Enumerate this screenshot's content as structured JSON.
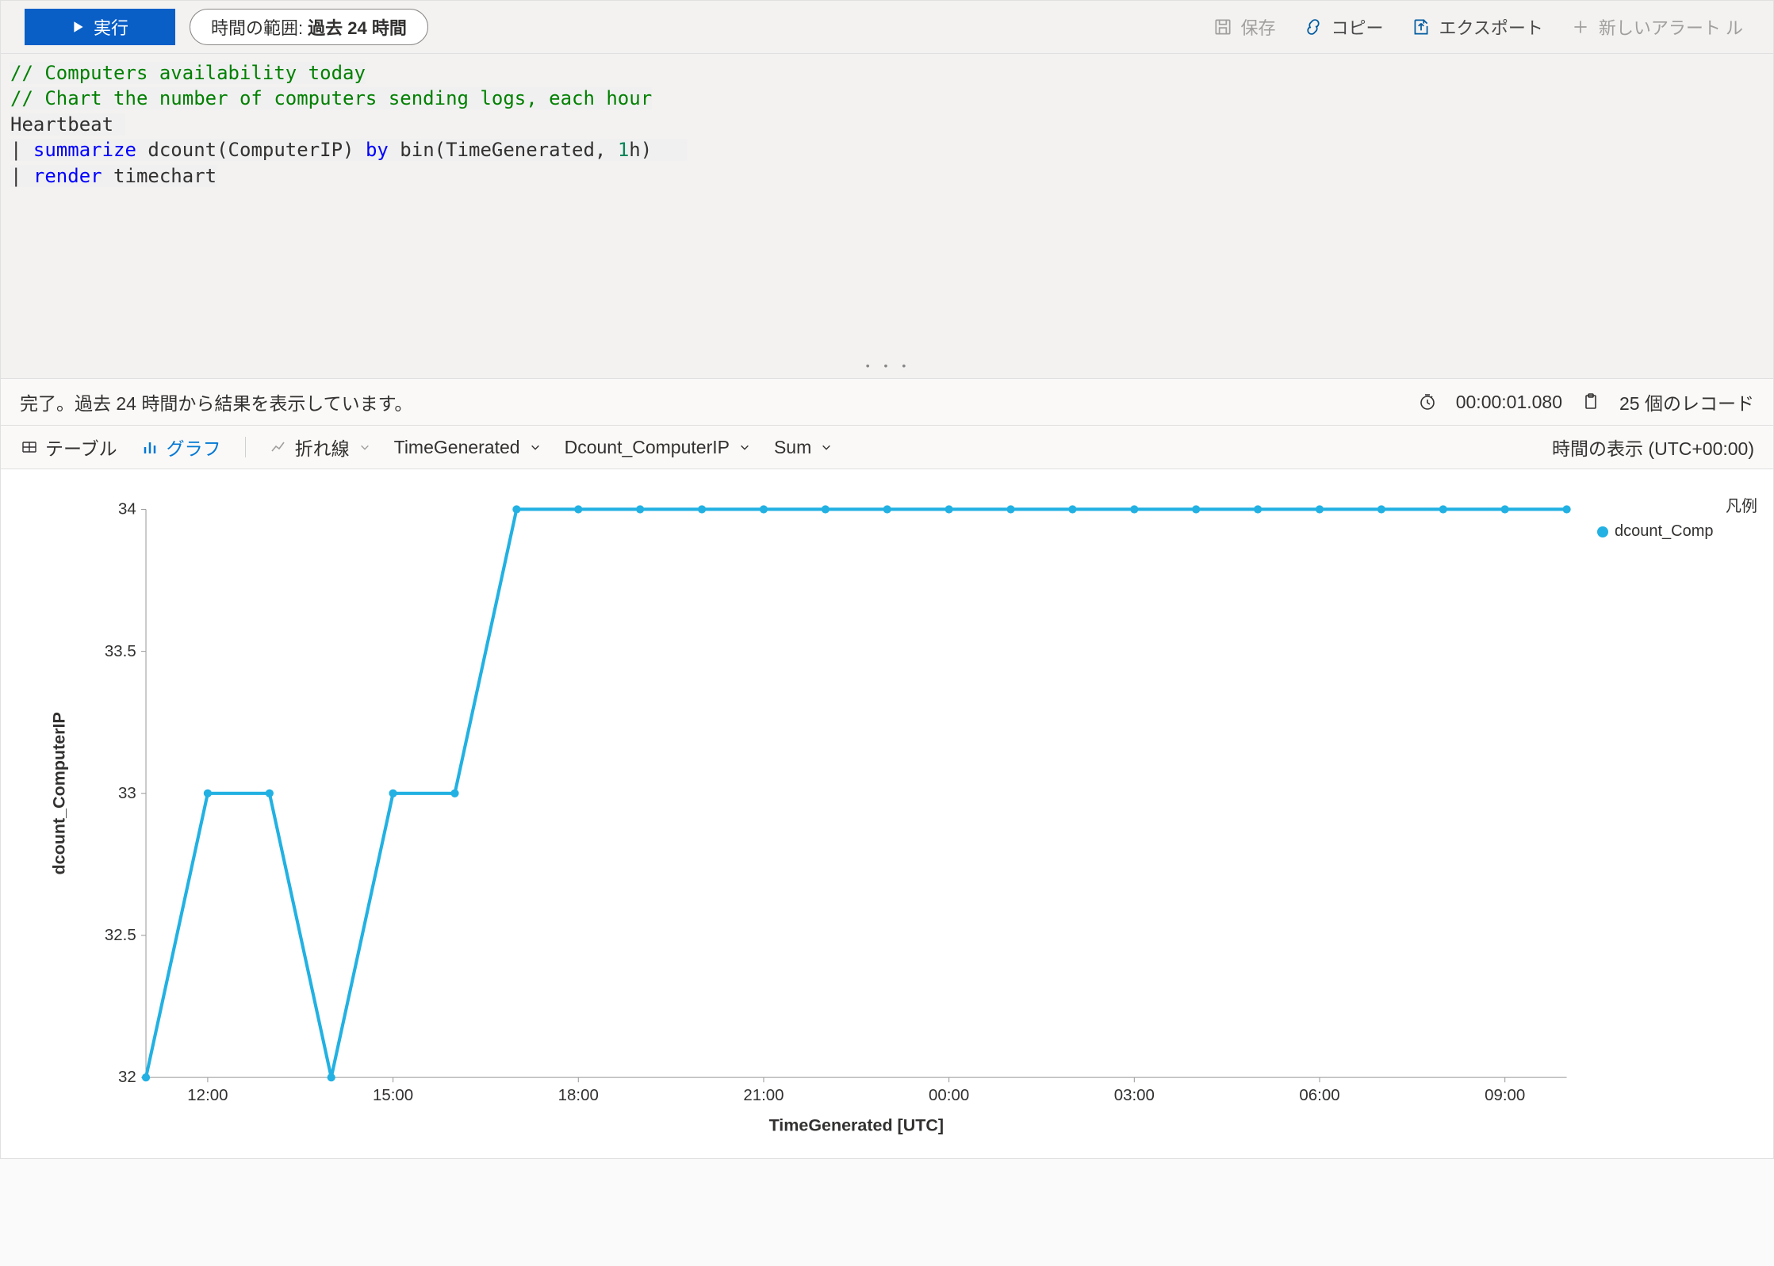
{
  "toolbar": {
    "run": "実行",
    "time_label": "時間の範囲:",
    "time_value": "過去 24 時間",
    "save": "保存",
    "copy": "コピー",
    "export": "エクスポート",
    "new_alert": "新しいアラート ル"
  },
  "editor": {
    "line1": "// Computers availability today",
    "line2": "// Chart the number of computers sending logs, each hour",
    "line3": "Heartbeat",
    "line4_kw1": "summarize",
    "line4_mid": " dcount(ComputerIP) ",
    "line4_kw2": "by",
    "line4_end": " bin(TimeGenerated, ",
    "line4_num": "1",
    "line4_tail": "h)",
    "line5_kw": "render",
    "line5_rest": " timechart"
  },
  "status": {
    "message": "完了。過去 24 時間から結果を表示しています。",
    "elapsed": "00:00:01.080",
    "records": "25 個のレコード"
  },
  "rtool": {
    "table": "テーブル",
    "chart": "グラフ",
    "chart_type": "折れ線",
    "xfield": "TimeGenerated",
    "yfield": "Dcount_ComputerIP",
    "agg": "Sum",
    "tz": "時間の表示 (UTC+00:00)"
  },
  "legend": {
    "title": "凡例",
    "series": "dcount_Comp"
  },
  "chart_data": {
    "type": "line",
    "title": "",
    "xlabel": "TimeGenerated [UTC]",
    "ylabel": "dcount_ComputerIP",
    "ylim": [
      32,
      34
    ],
    "yticks": [
      32,
      32.5,
      33,
      33.5,
      34
    ],
    "xticks": [
      "12:00",
      "15:00",
      "18:00",
      "21:00",
      "00:00",
      "03:00",
      "06:00",
      "09:00"
    ],
    "series": [
      {
        "name": "dcount_ComputerIP",
        "x": [
          "11:00",
          "12:00",
          "13:00",
          "14:00",
          "15:00",
          "16:00",
          "17:00",
          "18:00",
          "19:00",
          "20:00",
          "21:00",
          "22:00",
          "23:00",
          "00:00",
          "01:00",
          "02:00",
          "03:00",
          "04:00",
          "05:00",
          "06:00",
          "07:00",
          "08:00",
          "09:00",
          "10:00"
        ],
        "values": [
          32,
          33,
          33,
          32,
          33,
          33,
          34,
          34,
          34,
          34,
          34,
          34,
          34,
          34,
          34,
          34,
          34,
          34,
          34,
          34,
          34,
          34,
          34,
          34
        ]
      }
    ]
  }
}
